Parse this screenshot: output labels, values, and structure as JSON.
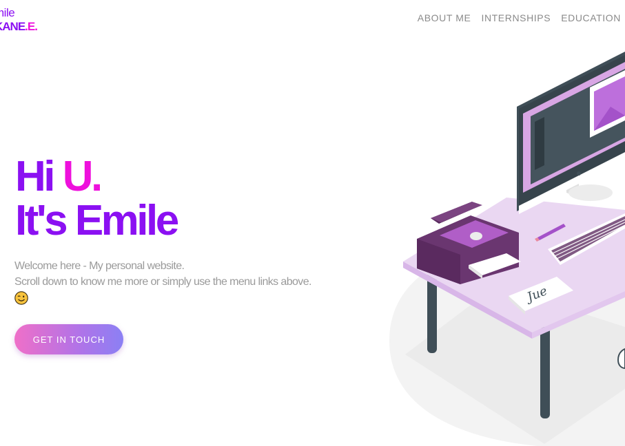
{
  "logo": {
    "first": "mile",
    "last": "KANE",
    "dot1": ".",
    "initial": "E",
    "dot2": "."
  },
  "nav": {
    "items": [
      "ABOUT ME",
      "INTERNSHIPS",
      "EDUCATION"
    ]
  },
  "hero": {
    "greeting_hi": "Hi",
    "greeting_u": "U.",
    "name_line": "It's Emile",
    "desc_line1": "Welcome here - My personal website.",
    "desc_line2": "Scroll down to know me more or simply use the menu links above.",
    "emoji": "winking-face-icon",
    "cta_label": "GET IN TOUCH"
  },
  "illustration": {
    "signature_text": "Jue"
  },
  "colors": {
    "purple": "#8b10f2",
    "magenta": "#ee10dc",
    "muted_text": "#9a9a9a",
    "nav_text": "#8a8a8a"
  }
}
